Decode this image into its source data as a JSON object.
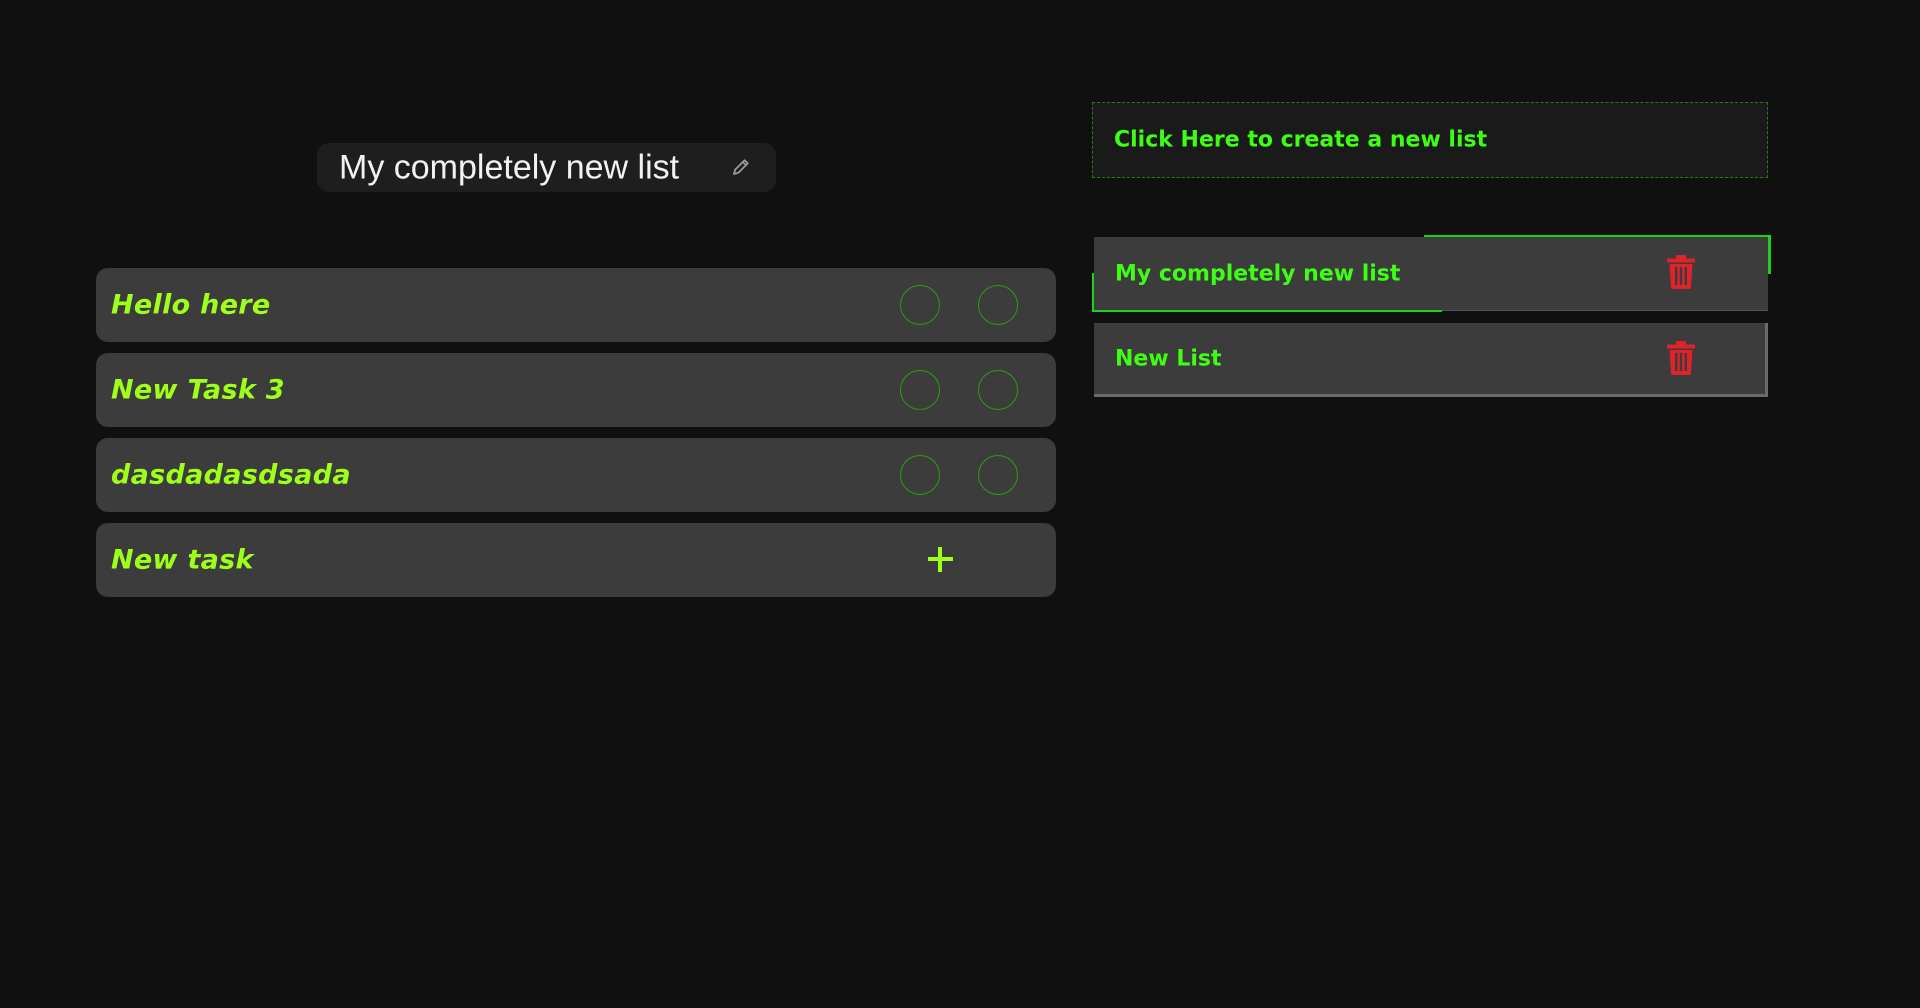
{
  "current_list": {
    "title": "My completely new list"
  },
  "tasks": [
    {
      "label": "Hello here"
    },
    {
      "label": "New Task 3"
    },
    {
      "label": "dasdadasdsada"
    }
  ],
  "new_task": {
    "label": "New task"
  },
  "sidebar": {
    "create_label": "Click Here to create a new list",
    "lists": [
      {
        "label": "My completely new list"
      },
      {
        "label": "New List"
      }
    ]
  },
  "icons": {
    "edit": "pencil-icon",
    "add": "plus-icon",
    "delete": "trash-icon"
  },
  "colors": {
    "background": "#101010",
    "task_text": "#9eff1a",
    "list_text": "#3cff14",
    "card": "#3c3c3c",
    "accent_border": "#1fd11f",
    "trash": "#e0222b"
  }
}
